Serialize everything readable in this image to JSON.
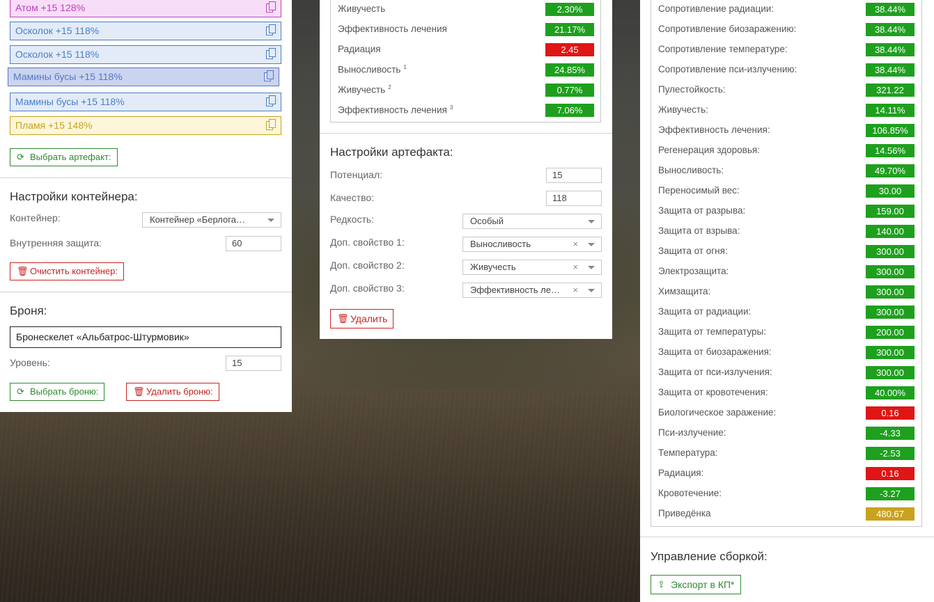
{
  "colors": {
    "positive": "#1ea01e",
    "negative": "#e01515",
    "gold": "#c9a21f",
    "green_btn": "#2e8b2e",
    "red_btn": "#cc2222"
  },
  "left": {
    "artifacts": [
      {
        "label": "Атом +15 128%",
        "color": "#c040c0",
        "bg": "#f8ddf8"
      },
      {
        "label": "Осколок +15 118%",
        "color": "#4a7fc8",
        "bg": "#e3ebf8"
      },
      {
        "label": "Осколок +15 118%",
        "color": "#4a7fc8",
        "bg": "#e3ebf8"
      },
      {
        "label": "Мамины бусы +15 118%",
        "color": "#5577c8",
        "bg": "#cbd4ee"
      },
      {
        "label": "Мамины бусы +15 118%",
        "color": "#4a7fc8",
        "bg": "#e3ebf8"
      },
      {
        "label": "Пламя +15 148%",
        "color": "#c9a21f",
        "bg": "#fdf6da"
      }
    ],
    "select_artifact_btn": "Выбрать артефакт:",
    "container": {
      "title": "Настройки контейнера:",
      "container_label": "Контейнер:",
      "container_value": "Контейнер «Берлога…",
      "inner_protection_label": "Внутренняя защита:",
      "inner_protection_value": "60",
      "clear_btn": "Очистить контейнер:"
    },
    "armor": {
      "title": "Броня:",
      "name": "Бронескелет «Альбатрос-Штурмовик»",
      "level_label": "Уровень:",
      "level_value": "15",
      "select_btn": "Выбрать броню:",
      "delete_btn": "Удалить броню:"
    }
  },
  "middle": {
    "stats": [
      {
        "label": "Живучесть",
        "sup": "",
        "value": "2.30%",
        "status": "positive"
      },
      {
        "label": "Эффективность лечения",
        "sup": "",
        "value": "21.17%",
        "status": "positive"
      },
      {
        "label": "Радиация",
        "sup": "",
        "value": "2.45",
        "status": "negative"
      },
      {
        "label": "Выносливость",
        "sup": "1",
        "value": "24.85%",
        "status": "positive"
      },
      {
        "label": "Живучесть",
        "sup": "2",
        "value": "0.77%",
        "status": "positive"
      },
      {
        "label": "Эффективность лечения",
        "sup": "3",
        "value": "7.06%",
        "status": "positive"
      }
    ],
    "settings": {
      "title": "Настройки артефакта:",
      "potential_label": "Потенциал:",
      "potential_value": "15",
      "quality_label": "Качество:",
      "quality_value": "118",
      "rarity_label": "Редкость:",
      "rarity_value": "Особый",
      "extra1_label": "Доп. свойство 1:",
      "extra1_value": "Выносливость",
      "extra2_label": "Доп. свойство 2:",
      "extra2_value": "Живучесть",
      "extra3_label": "Доп. свойство 3:",
      "extra3_value": "Эффективность ле…",
      "clear_symbol": "×",
      "delete_btn": "Удалить"
    }
  },
  "right": {
    "stats": [
      {
        "label": "Сопротивление радиации:",
        "value": "38.44%",
        "status": "positive"
      },
      {
        "label": "Сопротивление биозаражению:",
        "value": "38.44%",
        "status": "positive"
      },
      {
        "label": "Сопротивление температуре:",
        "value": "38.44%",
        "status": "positive"
      },
      {
        "label": "Сопротивление пси-излучению:",
        "value": "38.44%",
        "status": "positive"
      },
      {
        "label": "Пулестойкость:",
        "value": "321.22",
        "status": "positive"
      },
      {
        "label": "Живучесть:",
        "value": "14.11%",
        "status": "positive"
      },
      {
        "label": "Эффективность лечения:",
        "value": "106.85%",
        "status": "positive"
      },
      {
        "label": "Регенерация здоровья:",
        "value": "14.56%",
        "status": "positive"
      },
      {
        "label": "Выносливость:",
        "value": "49.70%",
        "status": "positive"
      },
      {
        "label": "Переносимый вес:",
        "value": "30.00",
        "status": "positive"
      },
      {
        "label": "Защита от разрыва:",
        "value": "159.00",
        "status": "positive"
      },
      {
        "label": "Защита от взрыва:",
        "value": "140.00",
        "status": "positive"
      },
      {
        "label": "Защита от огня:",
        "value": "300.00",
        "status": "positive"
      },
      {
        "label": "Электрозащита:",
        "value": "300.00",
        "status": "positive"
      },
      {
        "label": "Химзащита:",
        "value": "300.00",
        "status": "positive"
      },
      {
        "label": "Защита от радиации:",
        "value": "300.00",
        "status": "positive"
      },
      {
        "label": "Защита от температуры:",
        "value": "200.00",
        "status": "positive"
      },
      {
        "label": "Защита от биозаражения:",
        "value": "300.00",
        "status": "positive"
      },
      {
        "label": "Защита от пси-излучения:",
        "value": "300.00",
        "status": "positive"
      },
      {
        "label": "Защита от кровотечения:",
        "value": "40.00%",
        "status": "positive"
      },
      {
        "label": "Биологическое заражение:",
        "value": "0.16",
        "status": "negative"
      },
      {
        "label": "Пси-излучение:",
        "value": "-4.33",
        "status": "positive"
      },
      {
        "label": "Температура:",
        "value": "-2.53",
        "status": "positive"
      },
      {
        "label": "Радиация:",
        "value": "0.16",
        "status": "negative"
      },
      {
        "label": "Кровотечение:",
        "value": "-3.27",
        "status": "positive"
      },
      {
        "label": "Приведёнка",
        "value": "480.67",
        "status": "gold"
      }
    ],
    "build": {
      "title": "Управление сборкой:",
      "export_btn": "Экспорт в КП*"
    }
  }
}
